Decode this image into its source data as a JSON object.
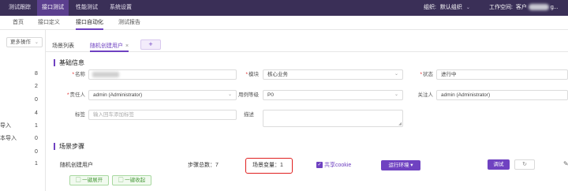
{
  "topnav": {
    "items": [
      "测试跟踪",
      "接口测试",
      "性能测试",
      "系统设置"
    ],
    "org_label": "组织:",
    "org_value": "默认组织",
    "workspace_label": "工作空间:",
    "workspace_value": "客户",
    "workspace_suffix": "g..."
  },
  "subnav": {
    "items": [
      "首页",
      "接口定义",
      "接口自动化",
      "测试报告"
    ]
  },
  "left": {
    "more_label": "更多操作",
    "rows": [
      {
        "text": "",
        "count": "8"
      },
      {
        "text": "",
        "count": "2"
      },
      {
        "text": "",
        "count": "0"
      },
      {
        "text": "",
        "count": "4"
      },
      {
        "text": "导入",
        "count": "1"
      },
      {
        "text": "本导入",
        "count": "0"
      },
      {
        "text": "",
        "count": "0"
      },
      {
        "text": "",
        "count": "1"
      }
    ]
  },
  "tabs": {
    "list_label": "场景列表",
    "active_label": "随机创建用户",
    "close": "×",
    "add": "+"
  },
  "basic": {
    "title": "基础信息",
    "name_label": "名称",
    "module_label": "模块",
    "module_value": "核心业务",
    "status_label": "状态",
    "status_value": "进行中",
    "owner_label": "责任人",
    "owner_value": "admin (Administrator)",
    "level_label": "用例等级",
    "level_value": "P0",
    "follower_label": "关注人",
    "follower_value": "admin (Administrator)",
    "tag_label": "标签",
    "tag_placeholder": "输入回车添加标签",
    "desc_label": "描述"
  },
  "steps": {
    "title": "场景步骤",
    "scenario_name": "随机创建用户",
    "step_total": "步骤总数：7",
    "variables": "场景变量：1",
    "share_cookie": "共享cookie",
    "env_button": "运行环境",
    "debug_button": "调试",
    "expand_all": "一键展开",
    "collapse_all": "一键收起"
  }
}
